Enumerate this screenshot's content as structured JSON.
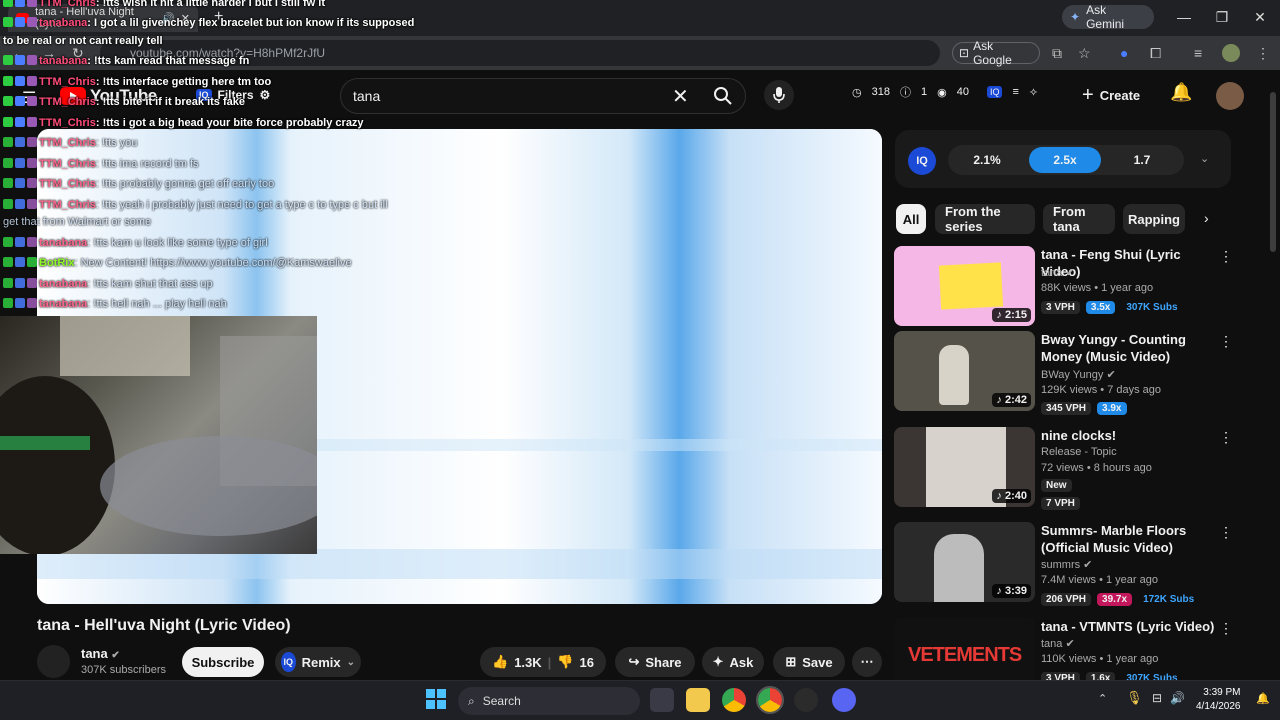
{
  "browser": {
    "tab_title": "tana - Hell'uva Night (Lyric",
    "ask_gemini": "Ask Gemini",
    "url": "youtube.com/watch?v=H8hPMf2rJfU",
    "ask_google": "Ask Google"
  },
  "youtube": {
    "logo": "YouTube",
    "filters": "Filters",
    "search_value": "tana",
    "stats": {
      "a": "318",
      "b": "1",
      "c": "40"
    },
    "create": "Create"
  },
  "chat": [
    {
      "user": "TTM_Chris",
      "msg": ": !tts wish it hit a little harder I but i still fw it",
      "color": "#ff4c7a"
    },
    {
      "user": "tanabana",
      "msg": ": I got a lil givenchey flex bracelet but ion know if its supposed",
      "color": "#ff4c7a"
    },
    {
      "user": "",
      "msg": "to be real or not cant really tell",
      "color": "#fff"
    },
    {
      "user": "tanabana",
      "msg": ": !tts kam read that message fn",
      "color": "#ff4c7a"
    },
    {
      "user": "TTM_Chris",
      "msg": ": !tts interface getting here tm too",
      "color": "#ff4c7a"
    },
    {
      "user": "TTM_Chris",
      "msg": ": !tts bite it if it break its fake",
      "color": "#ff4c7a"
    },
    {
      "user": "TTM_Chris",
      "msg": ": !tts i got a big head your bite force probably crazy",
      "color": "#ff4c7a"
    },
    {
      "user": "TTM_Chris",
      "msg": ": !tts you",
      "color": "#ff4c7a"
    },
    {
      "user": "TTM_Chris",
      "msg": ": !tts ima record tm fs",
      "color": "#ff4c7a"
    },
    {
      "user": "TTM_Chris",
      "msg": ": !tts probably gonna get off early too",
      "color": "#ff4c7a"
    },
    {
      "user": "TTM_Chris",
      "msg": ": !tts yeah i probably just need to get a type c to type c but ill",
      "color": "#ff4c7a"
    },
    {
      "user": "",
      "msg": "get that from Walmart or some",
      "color": "#fff"
    },
    {
      "user": "tanabana",
      "msg": ": !tts kam u look like some type of girl",
      "color": "#ff4c7a"
    },
    {
      "user": "BotRix",
      "msg": ": New Content! https://www.youtube.com/@Kamswaelive",
      "color": "#7cfc00"
    },
    {
      "user": "tanabana",
      "msg": ": !tts kam shut that ass up",
      "color": "#ff4c7a"
    },
    {
      "user": "tanabana",
      "msg": ": !tts hell nah ... play hell nah",
      "color": "#ff4c7a"
    }
  ],
  "video": {
    "title": "tana - Hell'uva Night (Lyric Video)",
    "channel": "tana",
    "subscribers": "307K subscribers",
    "subscribe": "Subscribe",
    "remix": "Remix",
    "likes": "1.3K",
    "dislikes": "16",
    "share": "Share",
    "ask": "Ask",
    "save": "Save"
  },
  "iq": {
    "logo": "IQ",
    "seg": [
      "2.1%",
      "2.5x",
      "1.7"
    ]
  },
  "chips": [
    "All",
    "From the series",
    "From tana",
    "Rapping"
  ],
  "recs": [
    {
      "title": "tana - Feng Shui (Lyric Video)",
      "channel": "tana",
      "meta": "88K views • 1 year ago",
      "dur": "♪ 2:15",
      "vph": "3 VPH",
      "x": "3.5x",
      "subs": "307K Subs",
      "thumb": "#f5b8e6"
    },
    {
      "title": "Bway Yungy - Counting Money (Music Video)",
      "channel": "BWay Yungy",
      "meta": "129K views • 7 days ago",
      "dur": "♪ 2:42",
      "vph": "345 VPH",
      "x": "3.9x",
      "subs": "",
      "thumb": "#55524a"
    },
    {
      "title": "nine clocks!",
      "channel": "Release - Topic",
      "meta": "72 views • 8 hours ago",
      "dur": "♪ 2:40",
      "vph": "7 VPH",
      "x": "",
      "subs": "",
      "new": "New",
      "thumb": "#3b3634"
    },
    {
      "title": "Summrs- Marble Floors (Official Music Video)",
      "channel": "summrs",
      "meta": "7.4M views • 1 year ago",
      "dur": "♪ 3:39",
      "vph": "206 VPH",
      "x": "39.7x",
      "subs": "172K Subs",
      "thumb": "#2a2a2a"
    },
    {
      "title": "tana - VTMNTS (Lyric Video)",
      "channel": "tana",
      "meta": "110K views • 1 year ago",
      "dur": "",
      "vph": "3 VPH",
      "x": "1.6x",
      "subs": "307K Subs",
      "thumb": "#111"
    }
  ],
  "taskbar": {
    "search": "Search",
    "time": "3:39 PM",
    "date": "4/14/2026"
  }
}
